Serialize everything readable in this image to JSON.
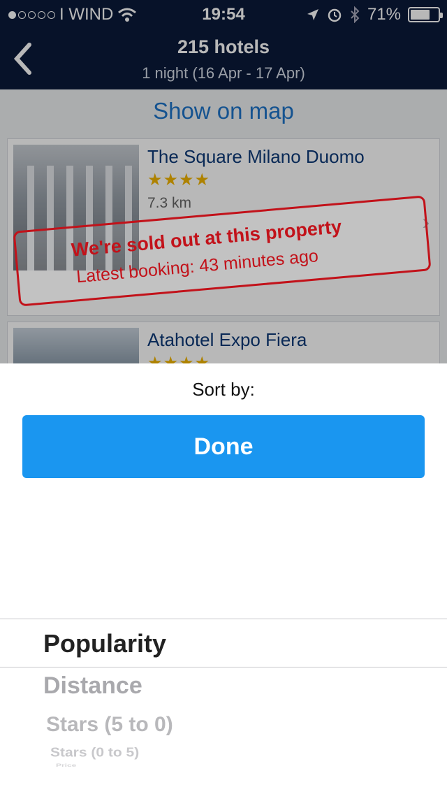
{
  "status_bar": {
    "carrier": "I WIND",
    "time": "19:54",
    "battery": "71%",
    "battery_level": 0.71,
    "signal_filled": 1,
    "signal_total": 5
  },
  "nav": {
    "title": "215 hotels",
    "subtitle": "1 night (16 Apr - 17 Apr)",
    "back_icon": "chevron-left-icon"
  },
  "list": {
    "show_on_map": "Show on map",
    "hotels": [
      {
        "name": "The Square Milano Duomo",
        "stars": "★★★★",
        "distance": "7.3 km",
        "stamp_line1": "We're sold out at this property",
        "stamp_line2": "Latest booking: 43 minutes ago"
      },
      {
        "name": "Atahotel Expo Fiera",
        "stars": "★★★★"
      }
    ]
  },
  "sheet": {
    "sort_by": "Sort by:",
    "done": "Done",
    "options": [
      "Popularity",
      "Distance",
      "Stars (5 to 0)",
      "Stars (0 to 5)",
      "Price"
    ],
    "selected": "Popularity"
  },
  "colors": {
    "nav_bg": "#0b1a3a",
    "link_blue": "#1e74c8",
    "done_blue": "#1a96f0",
    "stamp_red": "#c2121a",
    "star_gold": "#f2b500"
  }
}
